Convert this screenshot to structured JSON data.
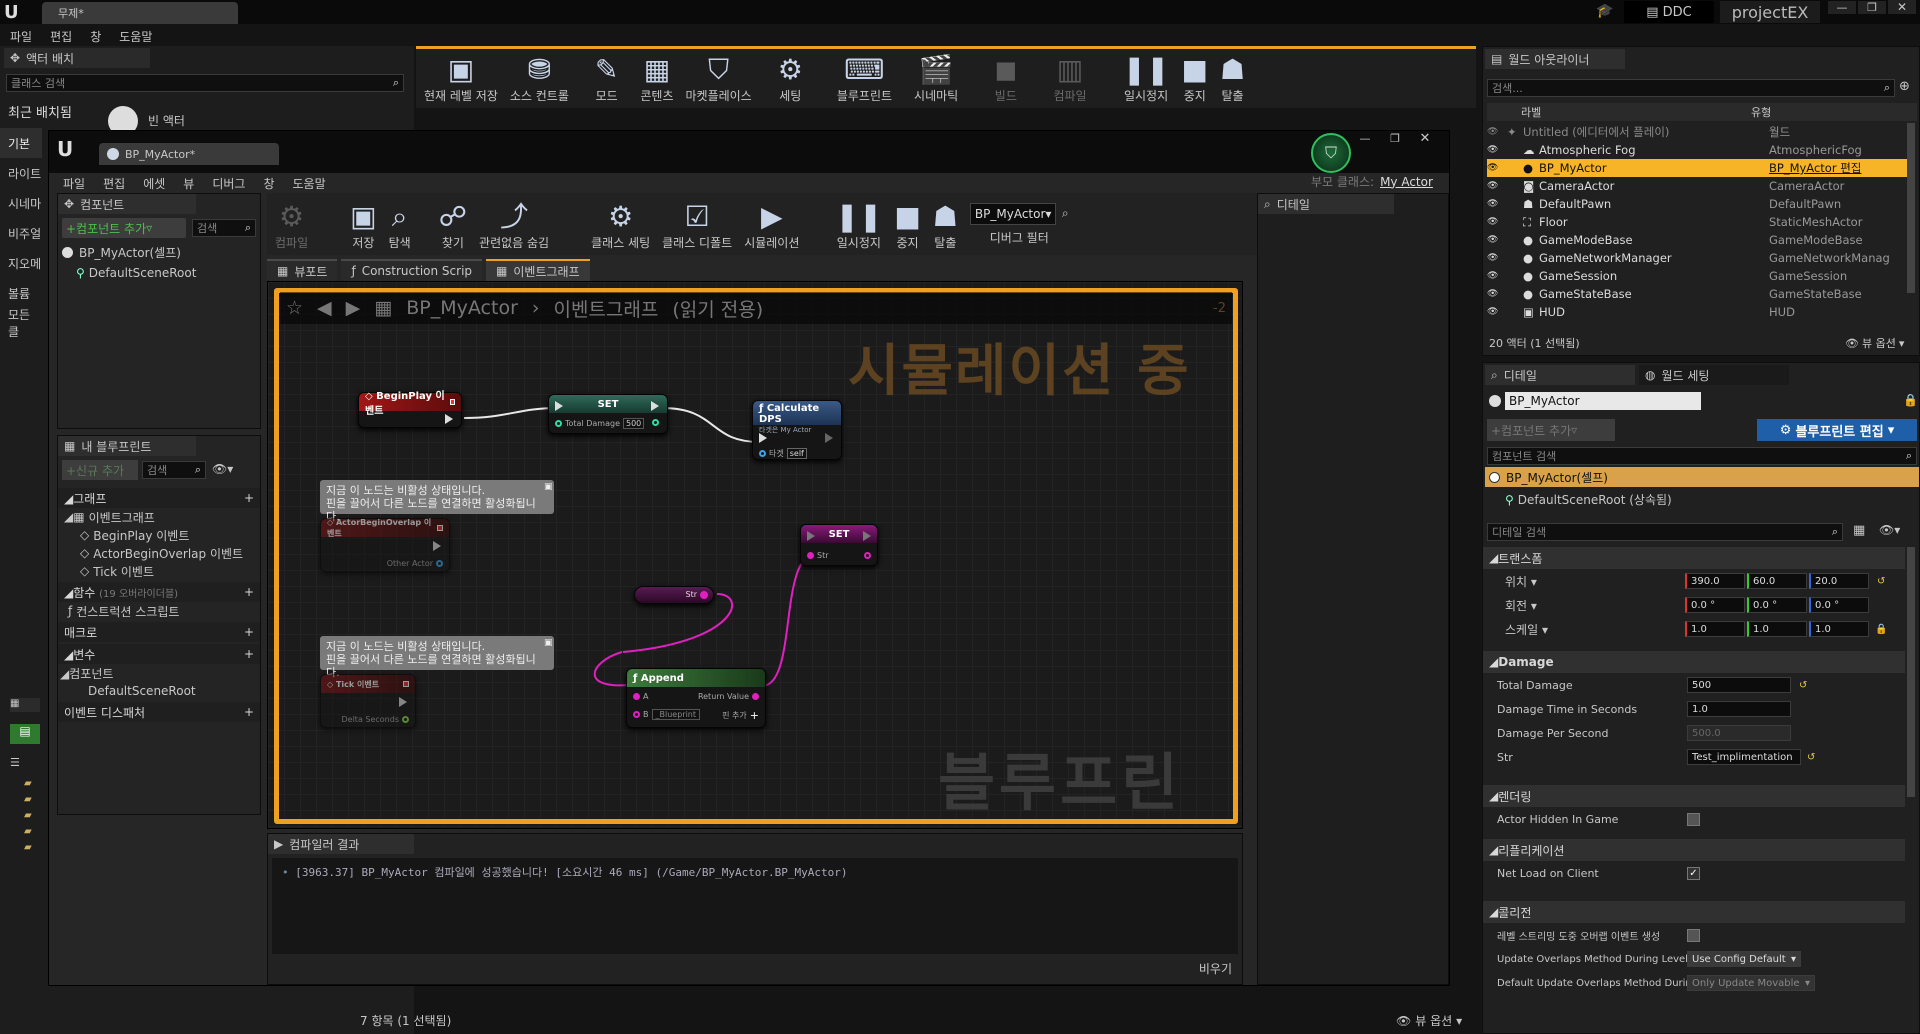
{
  "main": {
    "tab_title": "무제*",
    "menu": [
      "파일",
      "편집",
      "창",
      "도움말"
    ],
    "ddc_label": "DDC",
    "project_name": "projectEX",
    "toolbar": [
      {
        "label": "현재 레벨 저장",
        "icon": "save-icon"
      },
      {
        "label": "소스 컨트롤",
        "icon": "source-control-icon"
      },
      {
        "label": "모드",
        "icon": "modes-icon"
      },
      {
        "label": "콘텐츠",
        "icon": "content-icon"
      },
      {
        "label": "마켓플레이스",
        "icon": "marketplace-icon"
      },
      {
        "label": "세팅",
        "icon": "settings-icon"
      },
      {
        "label": "블루프린트",
        "icon": "blueprint-icon"
      },
      {
        "label": "시네마틱",
        "icon": "cinematic-icon"
      },
      {
        "label": "빌드",
        "icon": "build-icon",
        "disabled": true
      },
      {
        "label": "컴파일",
        "icon": "compile-icon",
        "disabled": true
      },
      {
        "label": "일시정지",
        "icon": "pause-icon"
      },
      {
        "label": "중지",
        "icon": "stop-icon"
      },
      {
        "label": "탈출",
        "icon": "eject-icon"
      }
    ]
  },
  "place_actors": {
    "tab": "액터 배치",
    "search_placeholder": "클래스 검색",
    "recent": "최근 배치됨",
    "empty_actor": "빈 액터",
    "categories": [
      "기본",
      "라이트",
      "시네마",
      "비주얼",
      "지오메",
      "볼륨",
      "모든 클"
    ]
  },
  "bp_editor": {
    "tab_title": "BP_MyActor*",
    "menu": [
      "파일",
      "편집",
      "에셋",
      "뷰",
      "디버그",
      "창",
      "도움말"
    ],
    "parent_label": "부모 클래스:",
    "parent_value": "My Actor",
    "toolbar": [
      {
        "label": "컴파일",
        "icon": "compile-icon",
        "disabled": true
      },
      {
        "label": "저장",
        "icon": "save-icon"
      },
      {
        "label": "탐색",
        "icon": "browse-icon"
      },
      {
        "label": "찾기",
        "icon": "find-icon"
      },
      {
        "label": "관련없음 숨김",
        "icon": "hide-unrelated-icon"
      },
      {
        "label": "클래스 세팅",
        "icon": "class-settings-icon"
      },
      {
        "label": "클래스 디폴트",
        "icon": "class-defaults-icon"
      },
      {
        "label": "시뮬레이션",
        "icon": "simulation-icon"
      },
      {
        "label": "일시정지",
        "icon": "pause-icon"
      },
      {
        "label": "중지",
        "icon": "stop-icon"
      },
      {
        "label": "탈출",
        "icon": "eject-icon"
      }
    ],
    "debug_select": "BP_MyActor",
    "debug_filter_label": "디버그 필터",
    "components": {
      "tab": "컴포넌트",
      "add_button": "+컴포넌트 추가",
      "search_placeholder": "검색",
      "self": "BP_MyActor(셀프)",
      "root": "DefaultSceneRoot"
    },
    "my_blueprint": {
      "tab": "내 블루프린트",
      "add_button": "+신규 추가",
      "search_placeholder": "검색",
      "graph_section": "그래프",
      "event_graph": "이벤트그래프",
      "events": [
        "BeginPlay 이벤트",
        "ActorBeginOverlap 이벤트",
        "Tick 이벤트"
      ],
      "functions_section": "함수",
      "functions_count": "(19 오버라이더블)",
      "construction_script": "컨스트럭션 스크립트",
      "macros_section": "매크로",
      "variables_section": "변수",
      "components_section": "컴포넌트",
      "default_root": "DefaultSceneRoot",
      "dispatchers_section": "이벤트 디스패처"
    },
    "doc_tabs": [
      "뷰포트",
      "Construction Scrip",
      "이벤트그래프"
    ],
    "breadcrumb_asset": "BP_MyActor",
    "breadcrumb_graph": "이벤트그래프",
    "read_only": "(읽기 전용)",
    "simulating_watermark": "시뮬레이션 중",
    "blueprint_watermark": "블루프린트",
    "zoom": "-2",
    "details_tab": "디테일",
    "nodes": {
      "beginplay": "BeginPlay 이벤트",
      "set1": "SET",
      "set1_pin": "Total Damage",
      "set1_value": "500",
      "calc": "Calculate DPS",
      "calc_sub": "타겟은 My Actor",
      "calc_target": "타겟",
      "calc_self": "self",
      "comment": "지금 이 노드는 비활성 상태입니다.\n핀을 끌어서 다른 노드를 연결하면 활성화됩니다.",
      "overlap": "ActorBeginOverlap 이벤트",
      "overlap_pin": "Other Actor",
      "tick": "Tick 이벤트",
      "tick_pin": "Delta Seconds",
      "set2": "SET",
      "set2_pin": "Str",
      "str_getter": "Str",
      "append": "Append",
      "append_a": "A",
      "append_b": "B",
      "append_b_value": "_Blueprint",
      "append_ret": "Return Value",
      "append_add": "핀 추가"
    },
    "compiler": {
      "tab": "컴파일러 결과",
      "message": "[3963.37] BP_MyActor 컴파일에 성공했습니다! [소요시간 46 ms] (/Game/BP_MyActor.BP_MyActor)",
      "clear": "비우기"
    }
  },
  "content_browser": {
    "status": "7 항목 (1 선택됨)",
    "view_options": "뷰 옵션"
  },
  "outliner": {
    "tab": "월드 아웃라이너",
    "search_placeholder": "검색...",
    "col_label": "라벨",
    "col_type": "유형",
    "rows": [
      {
        "label": "Untitled (에디터에서 플레이)",
        "type": "월드",
        "icon": "world-icon"
      },
      {
        "label": "Atmospheric Fog",
        "type": "AtmosphericFog",
        "icon": "fog-icon"
      },
      {
        "label": "BP_MyActor",
        "type": "BP_MyActor 편집",
        "icon": "actor-icon",
        "selected": true
      },
      {
        "label": "CameraActor",
        "type": "CameraActor",
        "icon": "camera-icon"
      },
      {
        "label": "DefaultPawn",
        "type": "DefaultPawn",
        "icon": "pawn-icon"
      },
      {
        "label": "Floor",
        "type": "StaticMeshActor",
        "icon": "mesh-icon"
      },
      {
        "label": "GameModeBase",
        "type": "GameModeBase",
        "icon": "actor-icon"
      },
      {
        "label": "GameNetworkManager",
        "type": "GameNetworkManag",
        "icon": "actor-icon"
      },
      {
        "label": "GameSession",
        "type": "GameSession",
        "icon": "actor-icon"
      },
      {
        "label": "GameStateBase",
        "type": "GameStateBase",
        "icon": "actor-icon"
      },
      {
        "label": "HUD",
        "type": "HUD",
        "icon": "hud-icon"
      }
    ],
    "status": "20 액터 (1 선택됨)",
    "view_options": "뷰 옵션"
  },
  "details": {
    "tab": "디테일",
    "world_settings_tab": "월드 세팅",
    "name": "BP_MyActor",
    "add_component": "+컴포넌트 추가",
    "edit_blueprint": "블루프린트 편집",
    "component_search": "컴포넌트 검색",
    "self": "BP_MyActor(셀프)",
    "root": "DefaultSceneRoot (상속됨)",
    "detail_search": "디테일 검색",
    "transform": {
      "section": "트랜스폼",
      "location": "위치",
      "rotation": "회전",
      "scale": "스케일",
      "loc": [
        "390.0",
        "60.0",
        "20.0"
      ],
      "rot": [
        "0.0 °",
        "0.0 °",
        "0.0 °"
      ],
      "scl": [
        "1.0",
        "1.0",
        "1.0"
      ]
    },
    "damage": {
      "section": "Damage",
      "props": [
        {
          "name": "Total Damage",
          "value": "500"
        },
        {
          "name": "Damage Time in Seconds",
          "value": "1.0"
        },
        {
          "name": "Damage Per Second",
          "value": "500.0"
        },
        {
          "name": "Str",
          "value": "Test_implimentation"
        }
      ]
    },
    "rendering": {
      "section": "렌더링",
      "hidden": "Actor Hidden In Game"
    },
    "replication": {
      "section": "리플리케이션",
      "net_load": "Net Load on Client"
    },
    "collision": {
      "section": "콜리전",
      "overlap_events": "레벨 스트리밍 도중 오버랩 이벤트 생성",
      "update_method": "Update Overlaps Method During Level",
      "update_value": "Use Config Default",
      "default_method": "Default Update Overlaps Method Durin",
      "default_value": "Only Update Movable"
    }
  },
  "colors": {
    "accent_orange": "#f0a020",
    "selection": "#f7b427",
    "exec_wire": "#e8e8e8",
    "string_pin": "#e020c0",
    "int_pin": "#2de0a0"
  }
}
